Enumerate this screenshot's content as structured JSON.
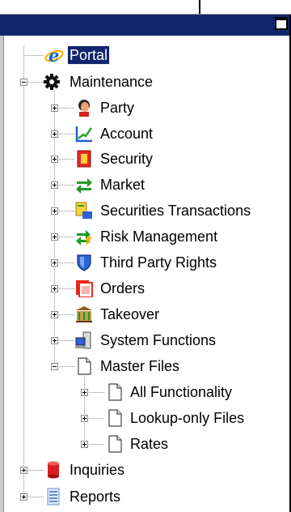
{
  "window": {
    "restore_icon": "window-restore-icon"
  },
  "tree": {
    "portal": {
      "label": "Portal",
      "icon": "internet-explorer-icon",
      "selected": true
    },
    "maintenance": {
      "label": "Maintenance",
      "icon": "gear-icon",
      "expanded": true,
      "children": [
        {
          "label": "Party",
          "icon": "person-icon",
          "expanded": false
        },
        {
          "label": "Account",
          "icon": "line-chart-icon",
          "expanded": false
        },
        {
          "label": "Security",
          "icon": "certificate-icon",
          "expanded": false
        },
        {
          "label": "Market",
          "icon": "exchange-arrows-icon",
          "expanded": false
        },
        {
          "label": "Securities Transactions",
          "icon": "transaction-icon",
          "expanded": false
        },
        {
          "label": "Risk Management",
          "icon": "risk-arrows-icon",
          "expanded": false
        },
        {
          "label": "Third Party Rights",
          "icon": "shield-icon",
          "expanded": false
        },
        {
          "label": "Orders",
          "icon": "orders-icon",
          "expanded": false
        },
        {
          "label": "Takeover",
          "icon": "bank-building-icon",
          "expanded": false
        },
        {
          "label": "System Functions",
          "icon": "computer-icon",
          "expanded": false
        },
        {
          "label": "Master Files",
          "icon": "document-icon",
          "expanded": true,
          "children": [
            {
              "label": "All Functionality",
              "icon": "document-icon",
              "expanded": false
            },
            {
              "label": "Lookup-only Files",
              "icon": "document-icon",
              "expanded": false
            },
            {
              "label": "Rates",
              "icon": "document-icon",
              "expanded": false
            }
          ]
        }
      ]
    },
    "inquiries": {
      "label": "Inquiries",
      "icon": "database-cylinder-icon",
      "expanded": false
    },
    "reports": {
      "label": "Reports",
      "icon": "report-list-icon",
      "expanded": false
    }
  },
  "colors": {
    "titlebar": "#11266e",
    "selection": "#11266e",
    "tree_line": "#8a8a8a"
  }
}
